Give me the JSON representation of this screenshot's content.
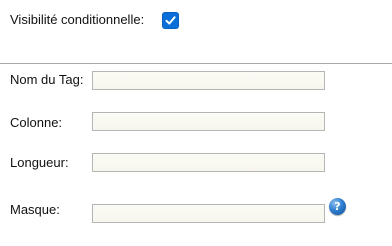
{
  "visibility": {
    "label": "Visibilité conditionnelle:",
    "checked": true
  },
  "fields": {
    "tag_name": {
      "label": "Nom du Tag:",
      "value": ""
    },
    "column": {
      "label": "Colonne:",
      "value": ""
    },
    "length": {
      "label": "Longueur:",
      "value": ""
    },
    "mask": {
      "label": "Masque:",
      "value": ""
    }
  },
  "help": {
    "glyph": "?",
    "icon": "help-icon",
    "color": "#2f7fd0"
  },
  "colors": {
    "checkbox": "#0a6fd8",
    "field_background": "#f8f7f0",
    "divider": "#a9a9a9"
  }
}
